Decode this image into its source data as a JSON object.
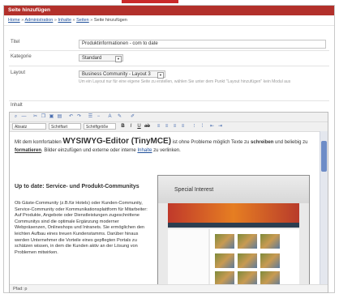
{
  "header": {
    "title": "Seite hinzufügen"
  },
  "breadcrumb": [
    {
      "label": "Home"
    },
    {
      "label": "Administration"
    },
    {
      "label": "Inhalte"
    },
    {
      "label": "Seiten"
    },
    {
      "label": "Seite hinzufügen"
    }
  ],
  "breadcrumb_separator": "»",
  "form": {
    "title_label": "Titel",
    "title_value": "Produktinformationen - com to date",
    "category_label": "Kategorie",
    "category_value": "Standard",
    "layout_label": "Layout",
    "layout_value": "Business Community - Layout 3",
    "layout_hint": "Um ein Layout nur für eine eigene Seite zu erstellen, wählen Sie unter dem Punkt \"Layout hinzufügen\" kein Modul aus",
    "content_label": "Inhalt"
  },
  "editor": {
    "toolbar_format": "Absatz",
    "toolbar_font": "Schriftart",
    "toolbar_size": "Schriftgröße",
    "intro_pre": "Mit dem komfortablen ",
    "intro_big": "WYSIWYG-Editor (TinyMCE)",
    "intro_mid1": " ist ohne Probleme möglich Texte zu ",
    "intro_bold": "schreiben",
    "intro_mid2": " und beliebig zu ",
    "intro_format": "formatieren",
    "intro_mid3": ". Bilder einzufügen und externe oder interne ",
    "intro_link": "Inhalte",
    "intro_end": " zu verlinken.",
    "heading": "Up to date: Service- und Produkt-Communitys",
    "body": "Ob Gäste-Community (z.B.für Hotels) oder Kunden-Community, Service-Community oder Kommunikationsplattform für Mitarbeiter: Auf Produkte, Angebote oder Dienstleistungen zugeschnittene Communitys sind die optimale Ergänzung moderner Webpräsenzen, Onlineshops und Intranets. Sie ermöglichen den leichten Aufbau eines treuen Kundenstamms. Darüber hinaus werden Unternehmer die Vorteile eines gepflegten Portals zu schätzen wissen, in dem die Kunden aktiv an der Lösung von Problemen mitwirken.",
    "embedded_title": "Special Interest",
    "status_path": "Pfad: p"
  },
  "colors": {
    "header": "#b2302b",
    "accent": "#c92a2a",
    "link": "#1f4f9a"
  }
}
